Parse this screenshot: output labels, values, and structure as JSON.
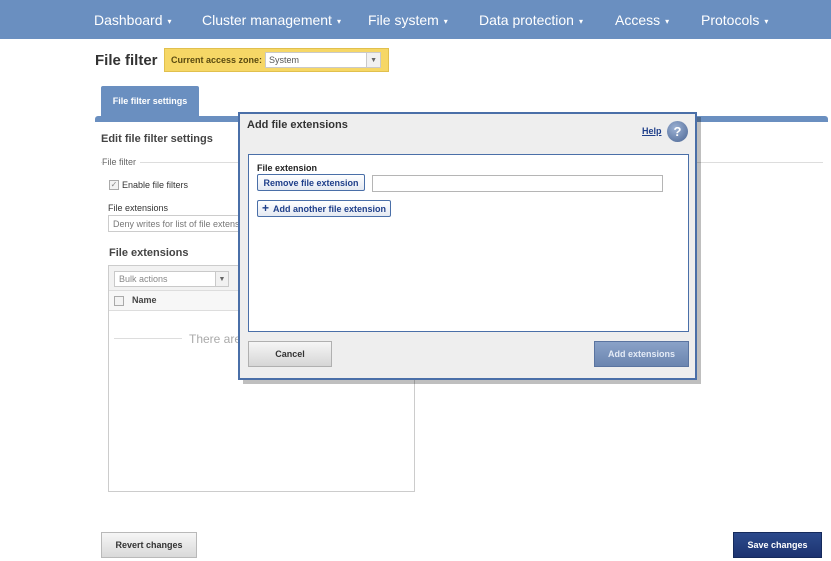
{
  "nav": {
    "items": [
      {
        "label": "Dashboard",
        "caret": "▾"
      },
      {
        "label": "Cluster management",
        "caret": "▾"
      },
      {
        "label": "File system",
        "caret": "▾"
      },
      {
        "label": "Data protection",
        "caret": "▾"
      },
      {
        "label": "Access",
        "caret": "▾"
      },
      {
        "label": "Protocols",
        "caret": "▾"
      }
    ]
  },
  "header": {
    "title": "File filter",
    "zone_label": "Current access zone:",
    "zone_value": "System"
  },
  "tabs": [
    {
      "label": "File filter settings"
    }
  ],
  "form": {
    "title": "Edit file filter settings",
    "legend": "File filter",
    "enable_label": "Enable file filters",
    "extensions_label": "File extensions",
    "deny_value": "Deny writes for list of file extensions",
    "list_heading": "File extensions",
    "bulk_placeholder": "Bulk actions",
    "col_name": "Name",
    "empty_text": "There are"
  },
  "buttons": {
    "revert": "Revert changes",
    "save": "Save changes"
  },
  "modal": {
    "title": "Add file extensions",
    "help": "Help",
    "help_glyph": "?",
    "field_label": "File extension",
    "remove_label": "Remove file extension",
    "add_another_label": "Add another file extension",
    "ext_value": "",
    "cancel_label": "Cancel",
    "add_label": "Add extensions"
  },
  "colors": {
    "nav_bg": "#6a8fc0",
    "zone_bg": "#f6d766",
    "save_bg": "#1c3370",
    "modal_border": "#4a6fa8"
  }
}
